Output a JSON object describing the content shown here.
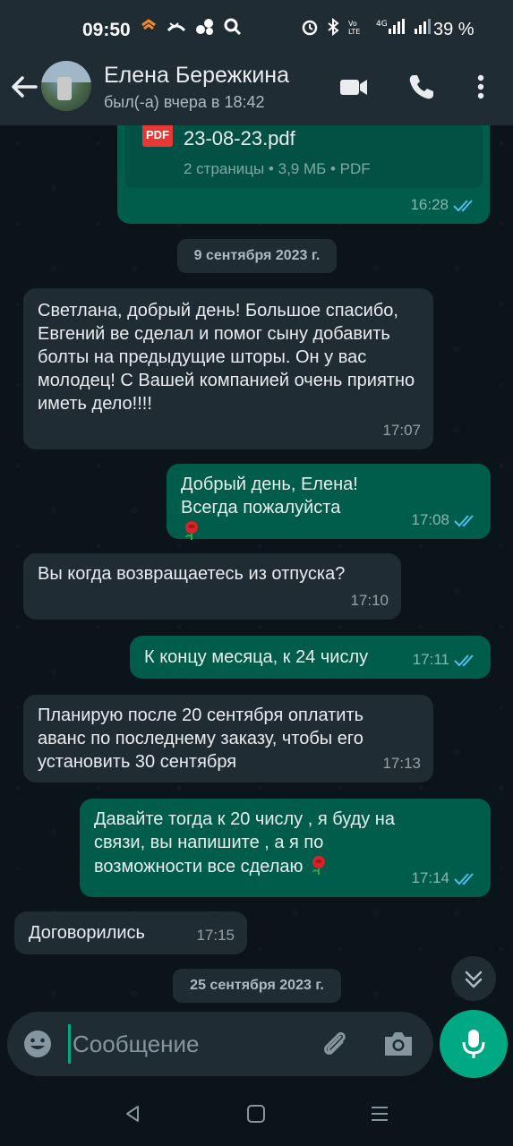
{
  "status_bar": {
    "time": "09:50",
    "battery": "39 %",
    "icons_left": [
      "taxi-icon",
      "missed-call-icon",
      "app-icon",
      "search-icon"
    ],
    "icons_right": [
      "alarm-icon",
      "bluetooth-icon",
      "volte-icon",
      "signal-4g-icon",
      "signal-icon"
    ]
  },
  "header": {
    "contact_name": "Елена Бережкина",
    "contact_status": "был(-а) вчера в 18:42"
  },
  "chat": {
    "pdf_message": {
      "file_name": "23-08-23.pdf",
      "file_info": "2 страницы • 3,9 МБ • PDF",
      "file_type_label": "PDF",
      "time": "16:28"
    },
    "date_separator_1": "9 сентября 2023 г.",
    "messages": [
      {
        "direction": "in",
        "text": "Светлана, добрый день! Большое спасибо, Евгений ве сделал и помог сыну добавить болты на предыдущие шторы. Он у вас молодец! С Вашей компанией очень приятно иметь дело!!!!",
        "time": "17:07"
      },
      {
        "direction": "out",
        "text": "Добрый день, Елена! Всегда пожалуйста",
        "time": "17:08",
        "emoji": "rose-emoji"
      },
      {
        "direction": "in",
        "text": "Вы когда возвращаетесь из отпуска?",
        "time": "17:10"
      },
      {
        "direction": "out",
        "text": "К концу месяца, к 24 числу",
        "time": "17:11"
      },
      {
        "direction": "in",
        "text": "Планирую после 20 сентября оплатить аванс по последнему заказу, чтобы его установить 30 сентября",
        "time": "17:13"
      },
      {
        "direction": "out",
        "text": "Давайте тогда к 20 числу , я буду на связи, вы напишите , а я по возможности все сделаю",
        "time": "17:14",
        "emoji": "rose-emoji"
      },
      {
        "direction": "in",
        "text": "Договорились",
        "time": "17:15"
      }
    ],
    "date_separator_2": "25 сентября 2023 г."
  },
  "input": {
    "placeholder": "Сообщение"
  },
  "colors": {
    "background": "#0b141a",
    "bar": "#1f2c34",
    "incoming": "#202c33",
    "outgoing": "#005c4b",
    "accent": "#00a884",
    "read_ticks": "#53bdeb"
  }
}
